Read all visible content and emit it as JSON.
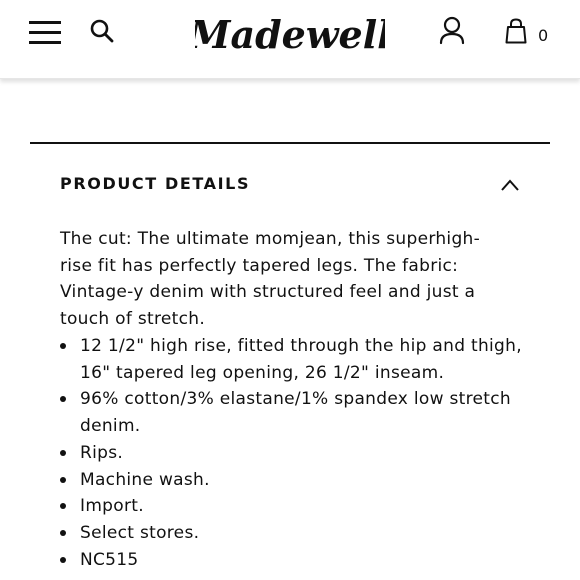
{
  "header": {
    "menu_icon": "hamburger-menu-icon",
    "search_icon": "search-icon",
    "logo_text": "Madewell",
    "account_icon": "user-icon",
    "bag_icon": "shopping-bag-icon",
    "bag_count": "0"
  },
  "product_details": {
    "title": "PRODUCT DETAILS",
    "toggle_icon": "chevron-up-icon",
    "description_lines": [
      "The cut: The ultimate momjean, this superhigh-",
      "rise fit has perfectly tapered legs. The fabric:",
      "Vintage-y denim with structured feel and just a",
      "touch of stretch."
    ],
    "features": [
      "12 1/2\" high rise, fitted through the hip and thigh, 16\" tapered leg opening, 26 1/2\" inseam.",
      "96% cotton/3% elastane/1% spandex low stretch denim.",
      "Rips.",
      "Machine wash.",
      "Import.",
      "Select stores.",
      "NC515"
    ]
  }
}
